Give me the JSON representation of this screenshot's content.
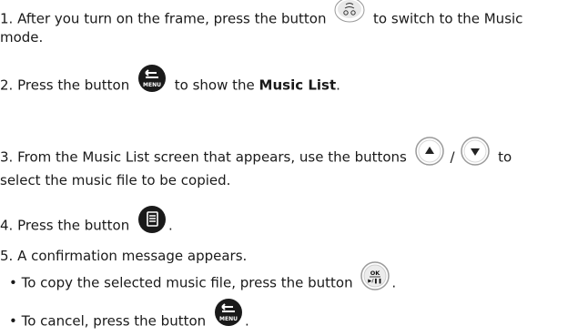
{
  "steps": [
    {
      "num": "1.",
      "part1": "After you turn on the frame, press the button",
      "part2": "to switch to the Music",
      "cont": "mode.",
      "icon": "mode-button-icon"
    },
    {
      "num": "2.",
      "part1": "Press the button",
      "part2": "to show the",
      "bold": "Music List",
      "end": ".",
      "icon": "back-menu-button-icon"
    },
    {
      "num": "3.",
      "part1": "From the Music List screen that appears, use the buttons",
      "sep": "/",
      "part2": "to",
      "cont": "select the music file to be copied.",
      "icons": [
        "up-button-icon",
        "down-button-icon"
      ]
    },
    {
      "num": "4.",
      "part1": "Press the button",
      "end": ".",
      "icon": "copy-button-icon"
    },
    {
      "num": "5.",
      "part1": "A confirmation message appears.",
      "bullets": [
        {
          "text": "• To copy the selected music file, press the button",
          "end": ".",
          "icon": "ok-play-pause-button-icon"
        },
        {
          "text": "• To cancel, press the button",
          "end": ".",
          "icon": "back-menu-button-icon"
        }
      ]
    }
  ],
  "icon_labels": {
    "ok_top": "OK",
    "ok_bottom": "▶/❚❚",
    "menu": "MENU"
  }
}
